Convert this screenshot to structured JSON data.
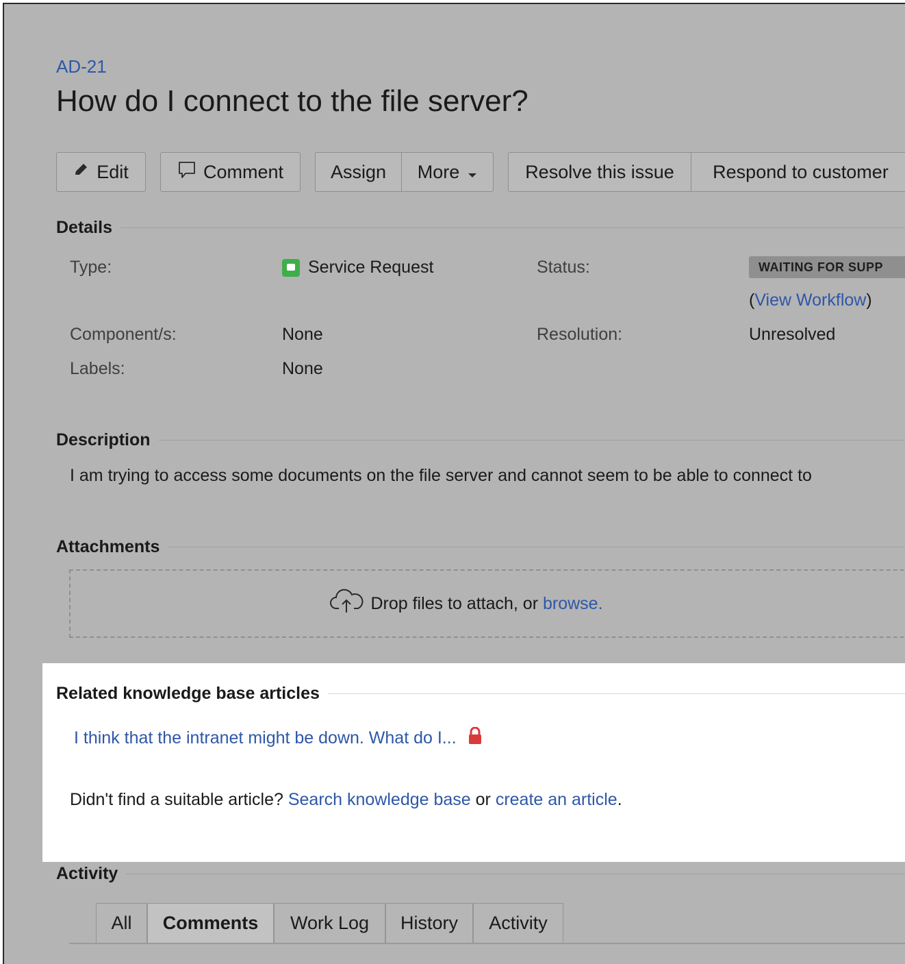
{
  "issue": {
    "key": "AD-21",
    "summary": "How do I connect to the file server?"
  },
  "toolbar": {
    "edit_label": "Edit",
    "comment_label": "Comment",
    "assign_label": "Assign",
    "more_label": "More",
    "resolve_label": "Resolve this issue",
    "respond_label": "Respond to customer"
  },
  "details": {
    "heading": "Details",
    "type_label": "Type:",
    "type_value": "Service Request",
    "status_label": "Status:",
    "status_value": "WAITING FOR SUPP",
    "view_workflow_open": "(",
    "view_workflow_link": "View Workflow",
    "view_workflow_close": ")",
    "components_label": "Component/s:",
    "components_value": "None",
    "resolution_label": "Resolution:",
    "resolution_value": "Unresolved",
    "labels_label": "Labels:",
    "labels_value": "None"
  },
  "description": {
    "heading": "Description",
    "text": "I am trying to access some documents on the file server and cannot seem to be able to connect to"
  },
  "attachments": {
    "heading": "Attachments",
    "drop_text": "Drop files to attach, or ",
    "browse_link": "browse."
  },
  "knowledge_base": {
    "heading": "Related knowledge base articles",
    "article_title": "I think that the intranet might be down. What do I...",
    "prompt_text": "Didn't find a suitable article? ",
    "search_link": "Search knowledge base",
    "or_text": " or ",
    "create_link": "create an article",
    "period": "."
  },
  "activity": {
    "heading": "Activity",
    "tabs": [
      "All",
      "Comments",
      "Work Log",
      "History",
      "Activity"
    ],
    "active_tab": "Comments"
  },
  "colors": {
    "link": "#2e57a8",
    "lock_icon": "#d93a3a",
    "service_request_icon": "#3fae49",
    "background_dimmed": "#b4b4b4"
  }
}
